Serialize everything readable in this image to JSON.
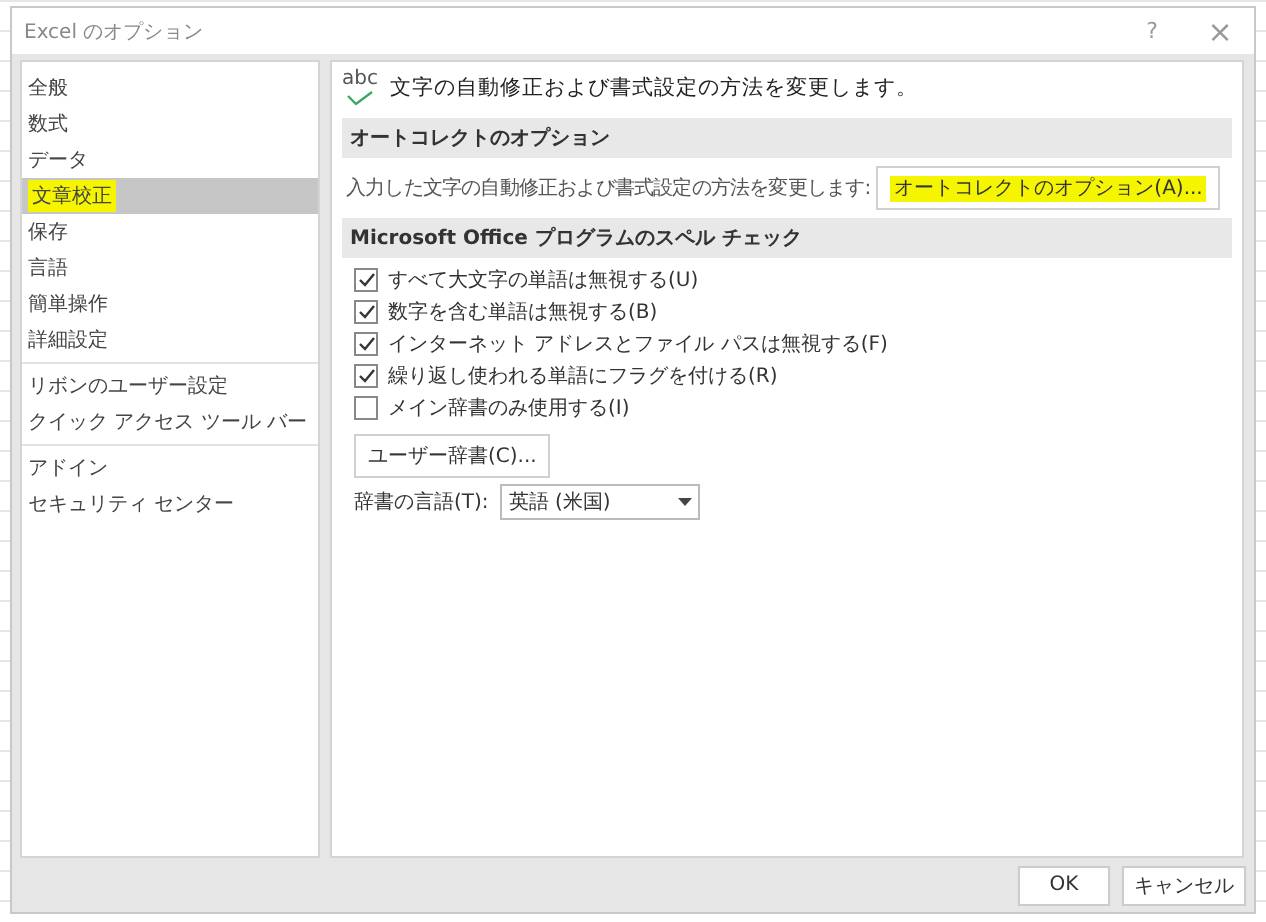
{
  "window": {
    "title": "Excel のオプション",
    "help": "?",
    "close": "×"
  },
  "sidebar": {
    "groups": [
      {
        "items": [
          {
            "label": "全般",
            "selected": false,
            "highlighted": false
          },
          {
            "label": "数式",
            "selected": false,
            "highlighted": false
          },
          {
            "label": "データ",
            "selected": false,
            "highlighted": false
          },
          {
            "label": "文章校正",
            "selected": true,
            "highlighted": true
          },
          {
            "label": "保存",
            "selected": false,
            "highlighted": false
          },
          {
            "label": "言語",
            "selected": false,
            "highlighted": false
          },
          {
            "label": "簡単操作",
            "selected": false,
            "highlighted": false
          },
          {
            "label": "詳細設定",
            "selected": false,
            "highlighted": false
          }
        ]
      },
      {
        "items": [
          {
            "label": "リボンのユーザー設定",
            "selected": false,
            "highlighted": false
          },
          {
            "label": "クイック アクセス ツール バー",
            "selected": false,
            "highlighted": false
          }
        ]
      },
      {
        "items": [
          {
            "label": "アドイン",
            "selected": false,
            "highlighted": false
          },
          {
            "label": "セキュリティ センター",
            "selected": false,
            "highlighted": false
          }
        ]
      }
    ]
  },
  "header": {
    "icon_text": "abc",
    "text": "文字の自動修正および書式設定の方法を変更します。"
  },
  "autocorrect": {
    "heading": "オートコレクトのオプション",
    "description": "入力した文字の自動修正および書式設定の方法を変更します:",
    "button": {
      "label": "オートコレクトのオプション(A)...",
      "highlighted": true
    }
  },
  "spelling": {
    "heading": "Microsoft Office プログラムのスペル チェック",
    "options": [
      {
        "label": "すべて大文字の単語は無視する(U)",
        "checked": true
      },
      {
        "label": "数字を含む単語は無視する(B)",
        "checked": true
      },
      {
        "label": "インターネット アドレスとファイル パスは無視する(F)",
        "checked": true
      },
      {
        "label": "繰り返し使われる単語にフラグを付ける(R)",
        "checked": true
      },
      {
        "label": "メイン辞書のみ使用する(I)",
        "checked": false
      }
    ],
    "dictionary_button": "ユーザー辞書(C)...",
    "language_label": "辞書の言語(T):",
    "language_value": "英語 (米国)"
  },
  "buttons": [
    "OK",
    "キャンセル"
  ]
}
